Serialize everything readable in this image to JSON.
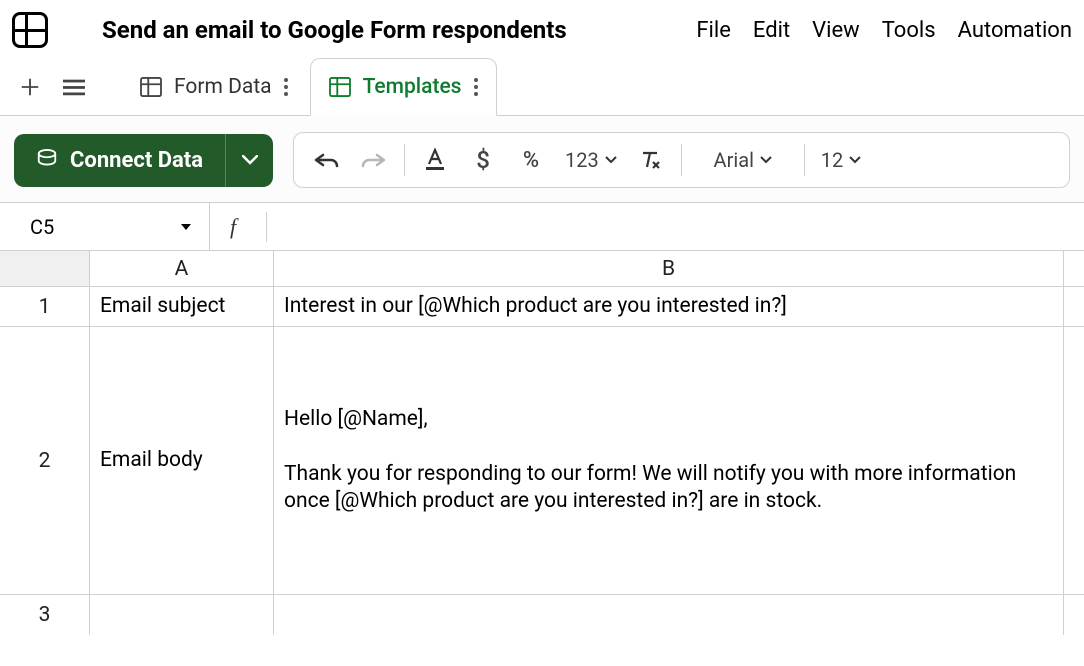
{
  "header": {
    "doc_title": "Send an email to Google Form respondents",
    "menu": {
      "file": "File",
      "edit": "Edit",
      "view": "View",
      "tools": "Tools",
      "automation": "Automation"
    }
  },
  "tabs": {
    "form_data": "Form Data",
    "templates": "Templates"
  },
  "actionbar": {
    "connect_label": "Connect Data",
    "number_format_label": "123",
    "font": "Arial",
    "font_size": "12"
  },
  "refbar": {
    "cell_ref": "C5",
    "fx_label": "f"
  },
  "grid": {
    "col_headers": {
      "a": "A",
      "b": "B"
    },
    "row_nums": {
      "r1": "1",
      "r2": "2",
      "r3": "3"
    },
    "cells": {
      "a1": "Email subject",
      "b1": "Interest in our [@Which product are you interested in?]",
      "a2": "Email body",
      "b2": "Hello [@Name],\n\nThank you for responding to our form! We will notify you with more information once [@Which product are you interested in?] are in stock."
    }
  }
}
